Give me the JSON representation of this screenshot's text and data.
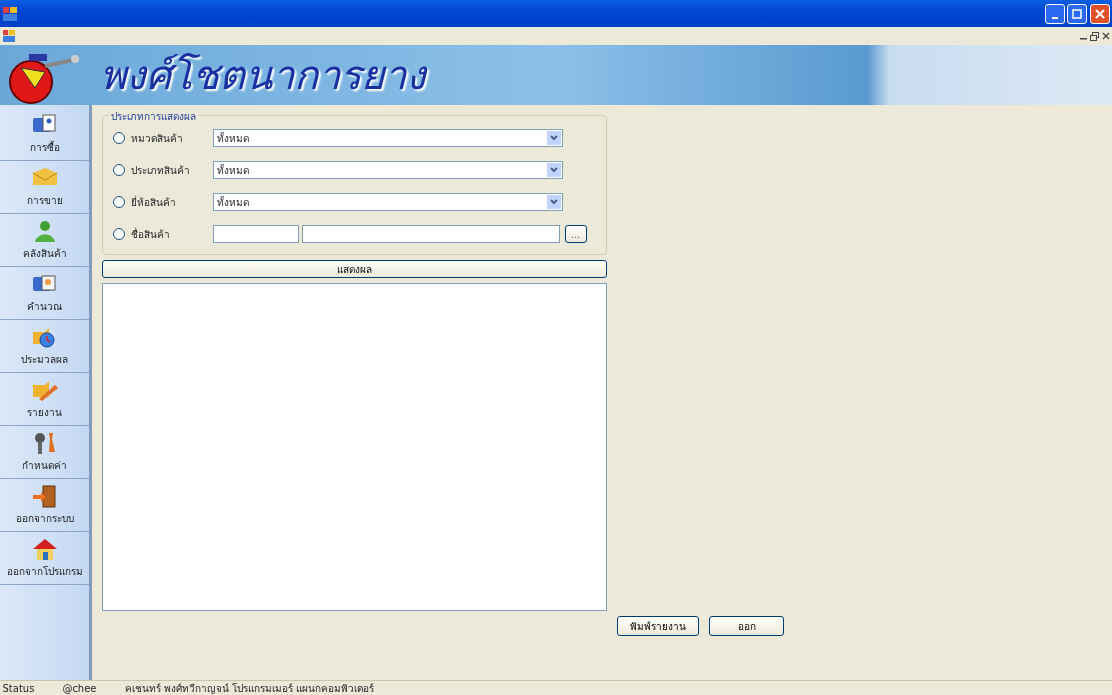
{
  "banner": {
    "title": "พงศ์โชตนาการยาง"
  },
  "sidebar": {
    "items": [
      {
        "label": "การซื้อ",
        "kind": "folder"
      },
      {
        "label": "การขาย",
        "kind": "mail"
      },
      {
        "label": "คลังสินค้า",
        "kind": "user"
      },
      {
        "label": "คำนวณ",
        "kind": "folder2"
      },
      {
        "label": "ประมวลผล",
        "kind": "clock"
      },
      {
        "label": "รายงาน",
        "kind": "pencil"
      },
      {
        "label": "กำหนดค่า",
        "kind": "tools"
      },
      {
        "label": "ออกจากระบบ",
        "kind": "door"
      },
      {
        "label": "ออกจากโปรแกรม",
        "kind": "house"
      }
    ]
  },
  "filter_group": {
    "legend": "ประเภทการแสดงผล",
    "options": [
      {
        "label": "หมวดสินค้า",
        "selected": false,
        "kind": "combo",
        "value": "ทั้งหมด"
      },
      {
        "label": "ประเภทสินค้า",
        "selected": false,
        "kind": "combo",
        "value": "ทั้งหมด"
      },
      {
        "label": "ยี่ห้อสินค้า",
        "selected": false,
        "kind": "combo",
        "value": "ทั้งหมด"
      },
      {
        "label": "ชื่อสินค้า",
        "selected": false,
        "kind": "text",
        "browse": "..."
      }
    ]
  },
  "show_button": "แสดงผล",
  "actions": [
    "พิมพ์รายงาน",
    "ออก"
  ],
  "status_bar": [
    "Status",
    "@chee",
    "คเชนทร์ พงศ์ทวีกาญจน์ โปรแกรมเมอร์ แผนกคอมพิวเตอร์"
  ]
}
